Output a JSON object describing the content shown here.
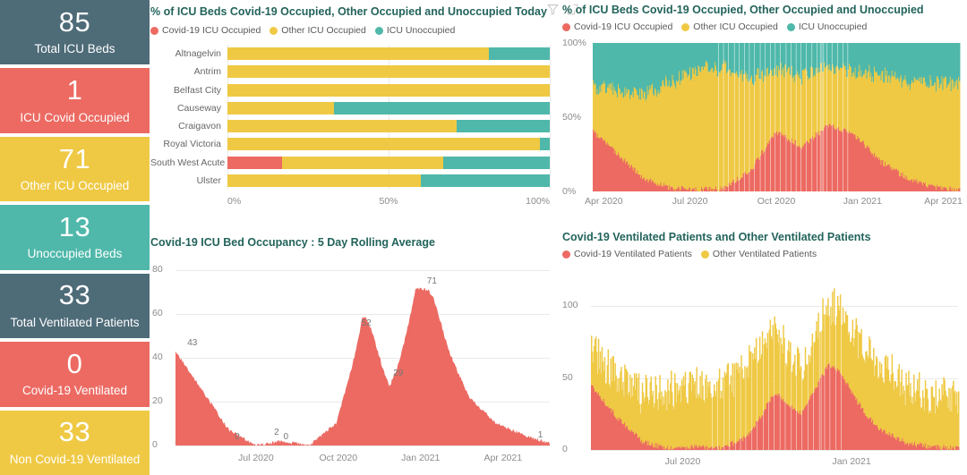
{
  "theme": {
    "covid_red": "#EC6A62",
    "other_yellow": "#EFC944",
    "unoccupied_teal": "#4FB8AA",
    "dark_slate": "#4E6B78",
    "title_green": "#22635B",
    "axis_gray": "#8b8b8b",
    "grid_gray": "#eaeaea",
    "page_bg": "#ffffff"
  },
  "kpis": [
    {
      "value": "85",
      "label": "Total ICU Beds",
      "color": "#4E6B78",
      "name": "total-icu-beds"
    },
    {
      "value": "1",
      "label": "ICU Covid Occupied",
      "color": "#EC6A62",
      "name": "icu-covid-occupied"
    },
    {
      "value": "71",
      "label": "Other ICU Occupied",
      "color": "#EFC944",
      "name": "other-icu-occupied"
    },
    {
      "value": "13",
      "label": "Unoccupied Beds",
      "color": "#4FB8AA",
      "name": "unoccupied-beds"
    },
    {
      "value": "33",
      "label": "Total Ventilated Patients",
      "color": "#4E6B78",
      "name": "total-ventilated-patients"
    },
    {
      "value": "0",
      "label": "Covid-19 Ventilated",
      "color": "#EC6A62",
      "name": "covid-19-ventilated"
    },
    {
      "value": "33",
      "label": "Non Covid-19 Ventilated",
      "color": "#EFC944",
      "name": "non-covid-19-ventilated"
    }
  ],
  "panel_hospital_bars": {
    "title": "% of ICU Beds Covid-19 Occupied, Other Occupied and Unoccupied Today",
    "icons": {
      "filter": "filter-icon",
      "focus": "focus-mode-icon"
    },
    "legend": [
      {
        "label": "Covid-19 ICU Occupied",
        "color": "#EC6A62"
      },
      {
        "label": "Other ICU Occupied",
        "color": "#EFC944"
      },
      {
        "label": "ICU Unoccupied",
        "color": "#4FB8AA"
      }
    ],
    "chart_data": {
      "type": "bar",
      "orientation": "horizontal",
      "stacked": true,
      "title": "% of ICU Beds Covid-19 Occupied, Other Occupied and Unoccupied Today",
      "xlabel": "",
      "ylabel": "",
      "xlim": [
        0,
        100
      ],
      "xticks": [
        "0%",
        "50%",
        "100%"
      ],
      "grid": true,
      "legend_position": "top",
      "categories": [
        "Altnagelvin",
        "Antrim",
        "Belfast City",
        "Causeway",
        "Craigavon",
        "Royal Victoria",
        "South West Acute",
        "Ulster"
      ],
      "series": [
        {
          "name": "Covid-19 ICU Occupied",
          "color": "#EC6A62",
          "values": [
            0,
            0,
            0,
            0,
            0,
            0,
            17,
            0
          ]
        },
        {
          "name": "Other ICU Occupied",
          "color": "#EFC944",
          "values": [
            81,
            100,
            100,
            33,
            71,
            97,
            50,
            60
          ]
        },
        {
          "name": "ICU Unoccupied",
          "color": "#4FB8AA",
          "values": [
            19,
            0,
            0,
            67,
            29,
            3,
            33,
            40
          ]
        }
      ]
    }
  },
  "panel_beds_timeseries": {
    "title": "% of ICU Beds Covid-19 Occupied, Other Occupied and Unoccupied",
    "legend": [
      {
        "label": "Covid-19 ICU Occupied",
        "color": "#EC6A62"
      },
      {
        "label": "Other ICU Occupied",
        "color": "#EFC944"
      },
      {
        "label": "ICU Unoccupied",
        "color": "#4FB8AA"
      }
    ],
    "chart_data": {
      "type": "area",
      "stacked": true,
      "title": "% of ICU Beds Covid-19 Occupied, Other Occupied and Unoccupied",
      "xlabel": "",
      "ylabel": "",
      "ylim": [
        0,
        100
      ],
      "yticks": [
        "0%",
        "50%",
        "100%"
      ],
      "xticks": [
        "Apr 2020",
        "Jul 2020",
        "Oct 2020",
        "Jan 2021",
        "Apr 2021"
      ],
      "grid": false,
      "legend_position": "top",
      "note": "Daily stacked percentage bars, Apr 2020 through mid 2021. Covid share peaks ~44% (Apr 2020), ~44% (Nov 2020) and ~48% (Jan 2021); near 0% over summer 2020 and from May 2021.",
      "series": [
        {
          "name": "Covid-19 ICU Occupied",
          "color": "#EC6A62",
          "sample_x": [
            "Apr 2020",
            "May 2020",
            "Jun 2020",
            "Jul 2020",
            "Aug 2020",
            "Sep 2020",
            "Oct 2020",
            "Nov 2020",
            "Dec 2020",
            "Jan 2021",
            "Feb 2021",
            "Mar 2021",
            "Apr 2021",
            "May 2021",
            "Jun 2021"
          ],
          "sample_values": [
            40,
            24,
            8,
            2,
            1,
            2,
            14,
            40,
            30,
            45,
            38,
            20,
            9,
            3,
            1
          ]
        },
        {
          "name": "Other ICU Occupied",
          "color": "#EFC944",
          "sample_x": [
            "Apr 2020",
            "May 2020",
            "Jun 2020",
            "Jul 2020",
            "Aug 2020",
            "Sep 2020",
            "Oct 2020",
            "Nov 2020",
            "Dec 2020",
            "Jan 2021",
            "Feb 2021",
            "Mar 2021",
            "Apr 2021",
            "May 2021",
            "Jun 2021"
          ],
          "sample_values": [
            30,
            44,
            58,
            72,
            80,
            82,
            62,
            42,
            48,
            38,
            42,
            58,
            65,
            70,
            72
          ]
        },
        {
          "name": "ICU Unoccupied",
          "color": "#4FB8AA",
          "sample_x": [
            "Apr 2020",
            "May 2020",
            "Jun 2020",
            "Jul 2020",
            "Aug 2020",
            "Sep 2020",
            "Oct 2020",
            "Nov 2020",
            "Dec 2020",
            "Jan 2021",
            "Feb 2021",
            "Mar 2021",
            "Apr 2021",
            "May 2021",
            "Jun 2021"
          ],
          "sample_values": [
            30,
            32,
            34,
            26,
            19,
            16,
            24,
            18,
            22,
            17,
            20,
            22,
            26,
            27,
            27
          ]
        }
      ]
    }
  },
  "panel_icu_rolling": {
    "title": "Covid-19 ICU Bed Occupancy : 5 Day Rolling Average",
    "chart_data": {
      "type": "area",
      "title": "Covid-19 ICU Bed Occupancy : 5 Day Rolling Average",
      "xlabel": "",
      "ylabel": "",
      "ylim": [
        0,
        80
      ],
      "yticks": [
        "0",
        "20",
        "40",
        "60",
        "80"
      ],
      "xticks": [
        "Jul 2020",
        "Oct 2020",
        "Jan 2021",
        "Apr 2021"
      ],
      "grid": true,
      "color": "#EC6A62",
      "data_labels": [
        {
          "text": "43",
          "x_pct": 4.5,
          "value": 43
        },
        {
          "text": "0",
          "x_pct": 16.5,
          "value": 0
        },
        {
          "text": "2",
          "x_pct": 27.0,
          "value": 2
        },
        {
          "text": "0",
          "x_pct": 29.5,
          "value": 0
        },
        {
          "text": "52",
          "x_pct": 51.0,
          "value": 52
        },
        {
          "text": "29",
          "x_pct": 59.5,
          "value": 29
        },
        {
          "text": "71",
          "x_pct": 68.5,
          "value": 71
        },
        {
          "text": "1",
          "x_pct": 97.5,
          "value": 1
        }
      ],
      "series": [
        {
          "name": "Covid-19 ICU Bed Occupancy (5 day rolling avg)",
          "color": "#EC6A62",
          "sample_x": [
            "Apr 2020",
            "May 2020",
            "Jun 2020",
            "Jul 2020",
            "Aug 2020",
            "Sep 2020",
            "Oct 2020",
            "Nov 2020",
            "Dec 2020",
            "Jan 2021",
            "Feb 2021",
            "Mar 2021",
            "Apr 2021",
            "May 2021",
            "Jun 2021"
          ],
          "sample_values": [
            43,
            25,
            7,
            0,
            2,
            0,
            10,
            52,
            29,
            71,
            48,
            22,
            10,
            5,
            1
          ]
        }
      ]
    }
  },
  "panel_ventilated": {
    "title": "Covid-19 Ventilated Patients and Other Ventilated Patients",
    "legend": [
      {
        "label": "Covid-19 Ventilated Patients",
        "color": "#EC6A62"
      },
      {
        "label": "Other Ventilated Patients",
        "color": "#EFC944"
      }
    ],
    "chart_data": {
      "type": "area",
      "stacked": true,
      "title": "Covid-19 Ventilated Patients and Other Ventilated Patients",
      "xlabel": "",
      "ylabel": "",
      "ylim": [
        0,
        110
      ],
      "yticks": [
        "0",
        "50",
        "100"
      ],
      "xticks": [
        "Jul 2020",
        "Jan 2021"
      ],
      "grid": true,
      "legend_position": "top",
      "series": [
        {
          "name": "Covid-19 Ventilated Patients",
          "color": "#EC6A62",
          "sample_x": [
            "Apr 2020",
            "May 2020",
            "Jun 2020",
            "Jul 2020",
            "Aug 2020",
            "Sep 2020",
            "Oct 2020",
            "Nov 2020",
            "Dec 2020",
            "Jan 2021",
            "Feb 2021",
            "Mar 2021",
            "Apr 2021",
            "May 2021",
            "Jun 2021"
          ],
          "sample_values": [
            45,
            22,
            5,
            1,
            2,
            1,
            10,
            40,
            25,
            56,
            35,
            14,
            5,
            2,
            1
          ]
        },
        {
          "name": "Other Ventilated Patients",
          "color": "#EFC944",
          "sample_x": [
            "Apr 2020",
            "May 2020",
            "Jun 2020",
            "Jul 2020",
            "Aug 2020",
            "Sep 2020",
            "Oct 2020",
            "Nov 2020",
            "Dec 2020",
            "Jan 2021",
            "Feb 2021",
            "Mar 2021",
            "Apr 2021",
            "May 2021",
            "Jun 2021"
          ],
          "sample_values": [
            25,
            28,
            33,
            40,
            42,
            45,
            48,
            45,
            30,
            42,
            45,
            45,
            40,
            35,
            35
          ]
        }
      ]
    }
  }
}
